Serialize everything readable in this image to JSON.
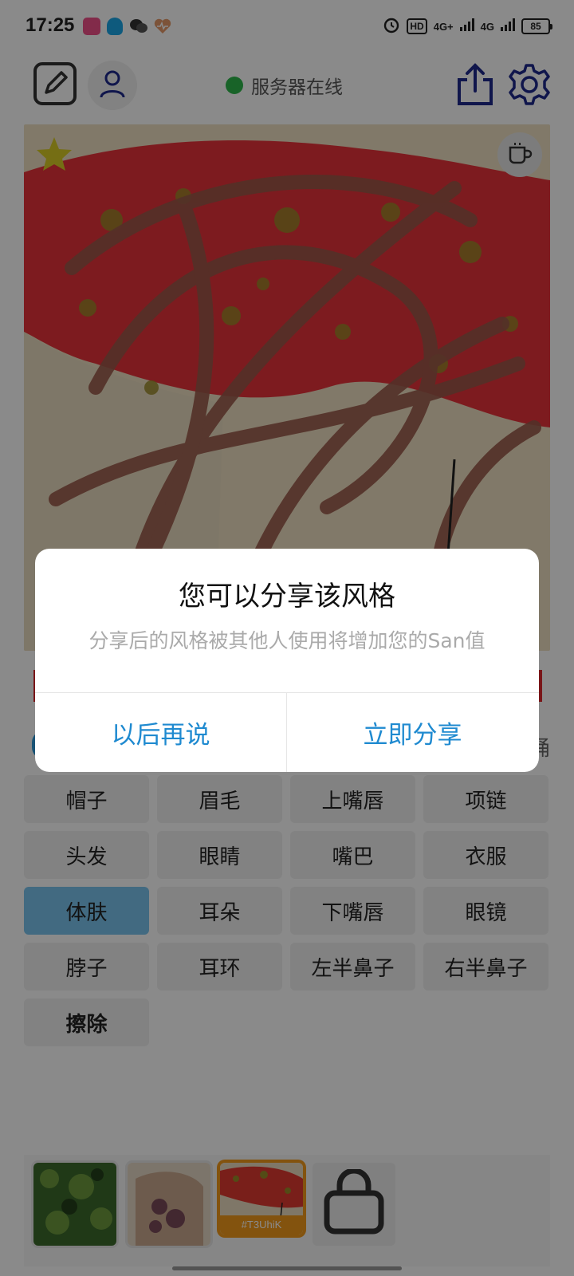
{
  "status_bar": {
    "time": "17:25",
    "signal_1": "4G+",
    "signal_2": "4G",
    "hd": "HD",
    "battery": "85"
  },
  "header": {
    "server_status": "服务器在线",
    "server_status_color": "#2db84a",
    "icons": [
      "pencil-square-icon",
      "user-icon",
      "share-icon",
      "gear-icon"
    ]
  },
  "canvas": {
    "icons": [
      "star-icon",
      "coffee-cup-icon"
    ]
  },
  "under_canvas": {
    "partial_label": "桶"
  },
  "parts": [
    {
      "label": "帽子",
      "active": false
    },
    {
      "label": "眉毛",
      "active": false
    },
    {
      "label": "上嘴唇",
      "active": false
    },
    {
      "label": "项链",
      "active": false
    },
    {
      "label": "头发",
      "active": false
    },
    {
      "label": "眼睛",
      "active": false
    },
    {
      "label": "嘴巴",
      "active": false
    },
    {
      "label": "衣服",
      "active": false
    },
    {
      "label": "体肤",
      "active": true
    },
    {
      "label": "耳朵",
      "active": false
    },
    {
      "label": "下嘴唇",
      "active": false
    },
    {
      "label": "眼镜",
      "active": false
    },
    {
      "label": "脖子",
      "active": false
    },
    {
      "label": "耳环",
      "active": false
    },
    {
      "label": "左半鼻子",
      "active": false
    },
    {
      "label": "右半鼻子",
      "active": false
    },
    {
      "label": "擦除",
      "active": false
    }
  ],
  "tray": {
    "selected_label": "#T3UhiK",
    "icons": [
      "shopping-bag-icon"
    ]
  },
  "dialog": {
    "title": "您可以分享该风格",
    "message": "分享后的风格被其他人使用将增加您的San值",
    "later_button": "以后再说",
    "share_button": "立即分享"
  },
  "colors": {
    "accent_blue": "#1f8ad0",
    "active_part": "#7ac4ee",
    "selected_style": "#f39a1a"
  }
}
